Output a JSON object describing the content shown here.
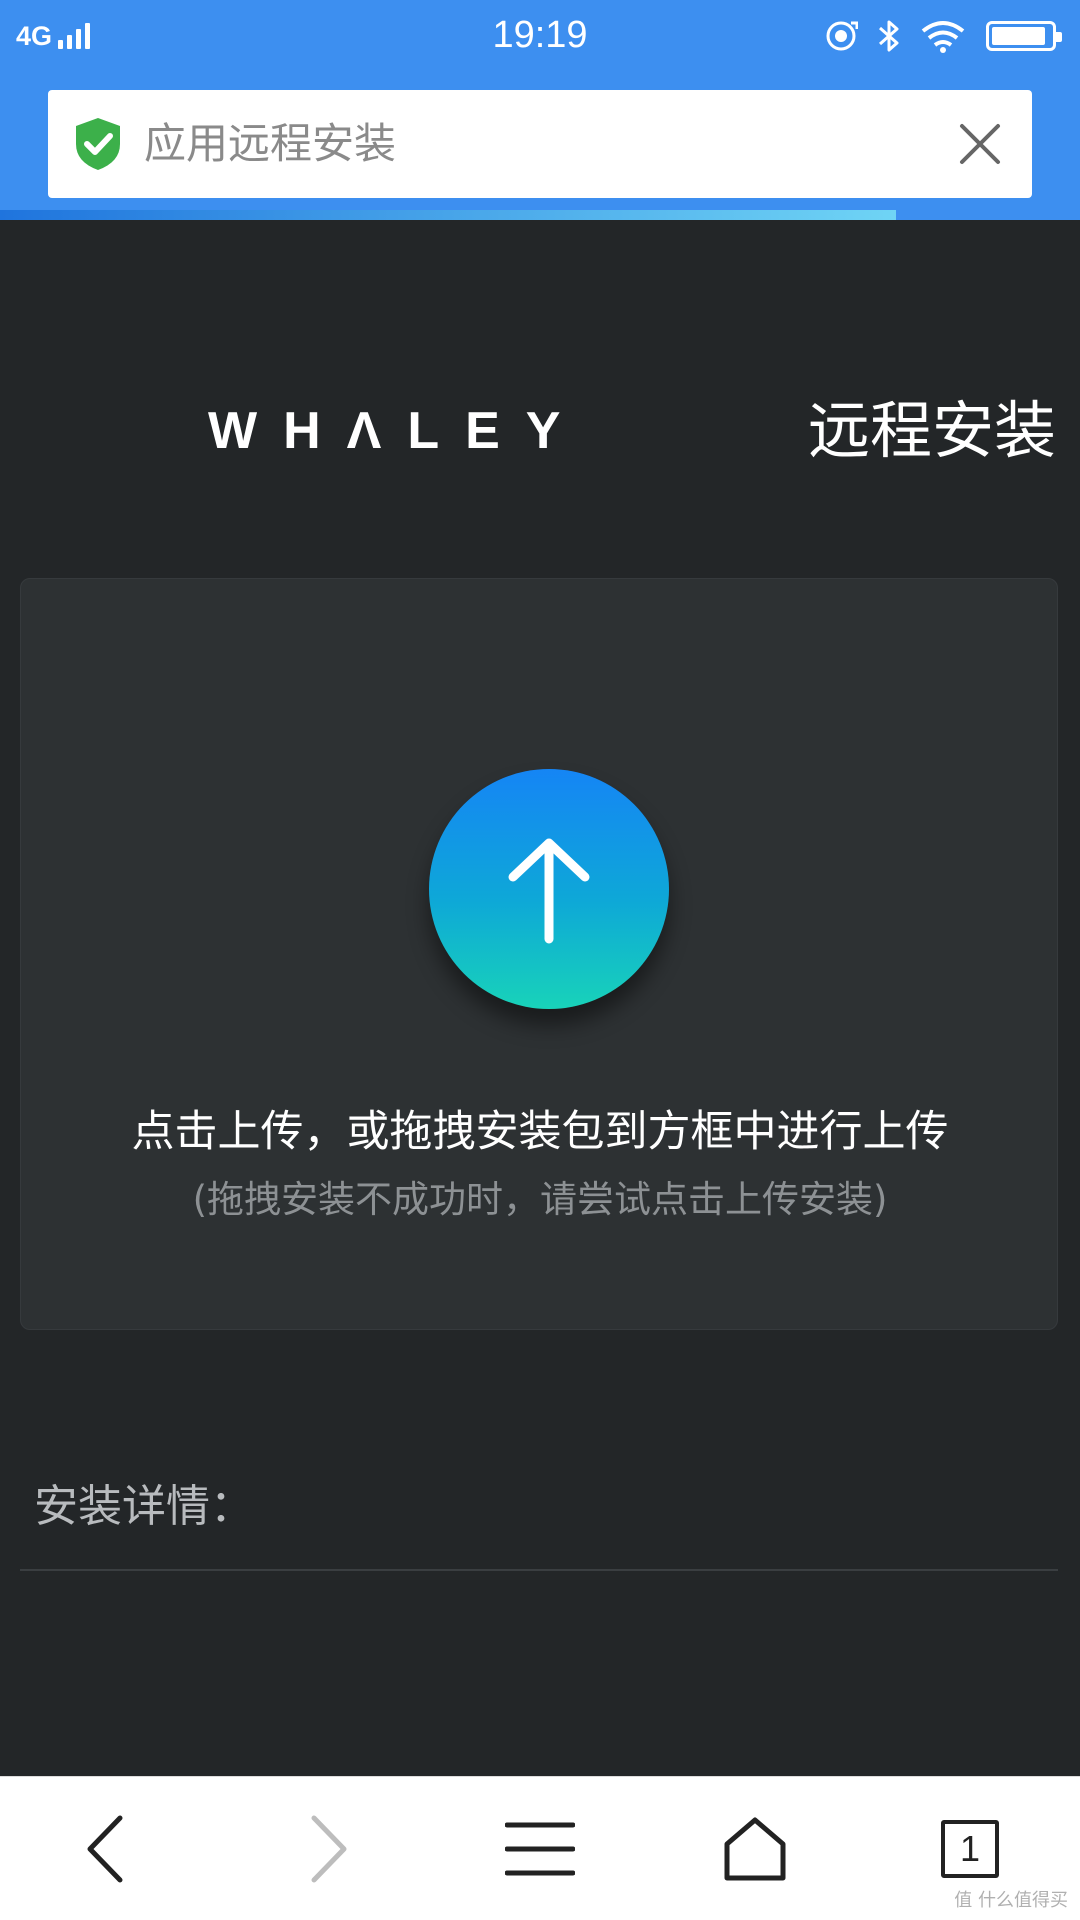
{
  "status_bar": {
    "network": "4G",
    "time": "19:19",
    "battery_level": 0.92
  },
  "browser": {
    "address_text": "应用远程安装",
    "load_progress": 0.83
  },
  "page": {
    "brand_logo": "WHΛLEY",
    "title": "远程安装",
    "upload_instruction": "点击上传，或拖拽安装包到方框中进行上传",
    "upload_hint": "(拖拽安装不成功时，请尝试点击上传安装)",
    "details_label": "安装详情："
  },
  "bottom_nav": {
    "tab_count": "1",
    "items": [
      "back-icon",
      "forward-icon",
      "menu-icon",
      "home-icon",
      "tabs-icon"
    ]
  },
  "watermark": "值 什么值得买",
  "colors": {
    "header_blue": "#3d8ff0",
    "page_background": "#232628",
    "upload_gradient_top": "#1585f5",
    "upload_gradient_bottom": "#18d3b9"
  }
}
